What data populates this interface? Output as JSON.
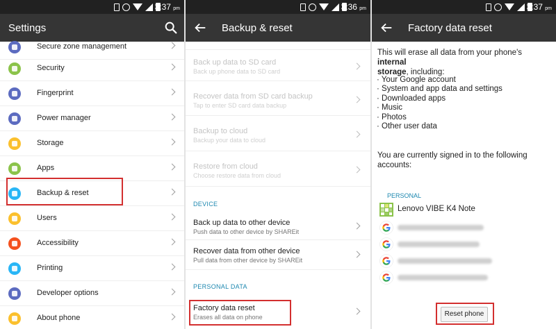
{
  "status_bars": [
    {
      "time": "3:37",
      "ampm": "pm"
    },
    {
      "time": "3:36",
      "ampm": "pm"
    },
    {
      "time": "3:37",
      "ampm": "pm"
    }
  ],
  "settings": {
    "title": "Settings",
    "items": [
      {
        "label": "Secure zone management",
        "icon": "shield-icon",
        "color": "#5c6bc0"
      },
      {
        "label": "Security",
        "icon": "lock-icon",
        "color": "#8bc34a"
      },
      {
        "label": "Fingerprint",
        "icon": "fingerprint-icon",
        "color": "#5c6bc0"
      },
      {
        "label": "Power manager",
        "icon": "battery-icon",
        "color": "#5c6bc0"
      },
      {
        "label": "Storage",
        "icon": "storage-icon",
        "color": "#fbc02d"
      },
      {
        "label": "Apps",
        "icon": "android-icon",
        "color": "#8bc34a"
      },
      {
        "label": "Backup & reset",
        "icon": "backup-icon",
        "color": "#29b6f6"
      },
      {
        "label": "Users",
        "icon": "user-icon",
        "color": "#fbc02d"
      },
      {
        "label": "Accessibility",
        "icon": "accessibility-icon",
        "color": "#f4511e"
      },
      {
        "label": "Printing",
        "icon": "printer-icon",
        "color": "#29b6f6"
      },
      {
        "label": "Developer options",
        "icon": "code-icon",
        "color": "#5c6bc0"
      },
      {
        "label": "About phone",
        "icon": "info-icon",
        "color": "#fbc02d"
      }
    ]
  },
  "backup": {
    "title": "Backup & reset",
    "items": [
      {
        "title": "Back up data to SD card",
        "subtitle": "Back up phone data to SD card"
      },
      {
        "title": "Recover data from SD card backup",
        "subtitle": "Tap to enter SD card data backup"
      },
      {
        "title": "Backup to cloud",
        "subtitle": "Backup your data to cloud"
      },
      {
        "title": "Restore from cloud",
        "subtitle": "Choose restore data from cloud"
      }
    ],
    "device_header": "DEVICE",
    "device_items": [
      {
        "title": "Back up data to other device",
        "subtitle": "Push data to other device by SHAREit"
      },
      {
        "title": "Recover data from other device",
        "subtitle": "Pull data from other device by SHAREit"
      }
    ],
    "personal_header": "PERSONAL DATA",
    "factory": {
      "title": "Factory data reset",
      "subtitle": "Erases all data on phone"
    }
  },
  "factory_reset": {
    "title": "Factory data reset",
    "intro_line1": "This will erase all data from your phone's ",
    "intro_bold1": "internal",
    "intro_bold2": "storage",
    "intro_line2_rest": ", including:",
    "bullets": [
      "· Your Google account",
      "· System and app data and settings",
      "· Downloaded apps",
      "· Music",
      "· Photos",
      "· Other user data"
    ],
    "signed_in_line1": "You are currently signed in to the following",
    "signed_in_line2": "accounts:",
    "personal_header": "PERSONAL",
    "device_account": "Lenovo VIBE K4 Note",
    "reset_button": "Reset phone"
  },
  "colors": {
    "appbar": "#353535",
    "statusbar": "#212121",
    "accent": "#1e88b0",
    "highlight": "#d32f2f"
  }
}
